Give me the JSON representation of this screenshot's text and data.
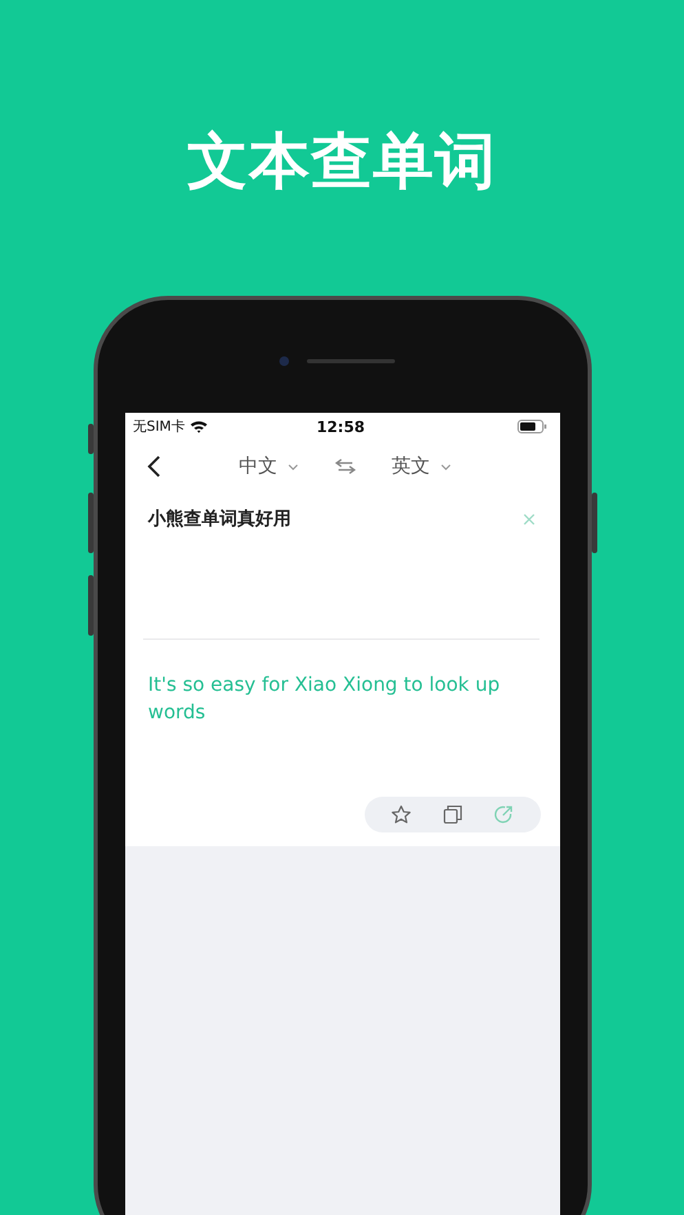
{
  "headline": "文本查单词",
  "status_bar": {
    "carrier": "无SIM卡",
    "time": "12:58"
  },
  "nav": {
    "source_language": "中文",
    "target_language": "英文"
  },
  "input": {
    "value": "小熊查单词真好用"
  },
  "translation": {
    "text": "It's so easy for Xiao Xiong to look up words"
  },
  "actions": [
    {
      "kind": "star"
    },
    {
      "kind": "copy"
    },
    {
      "kind": "share"
    }
  ]
}
